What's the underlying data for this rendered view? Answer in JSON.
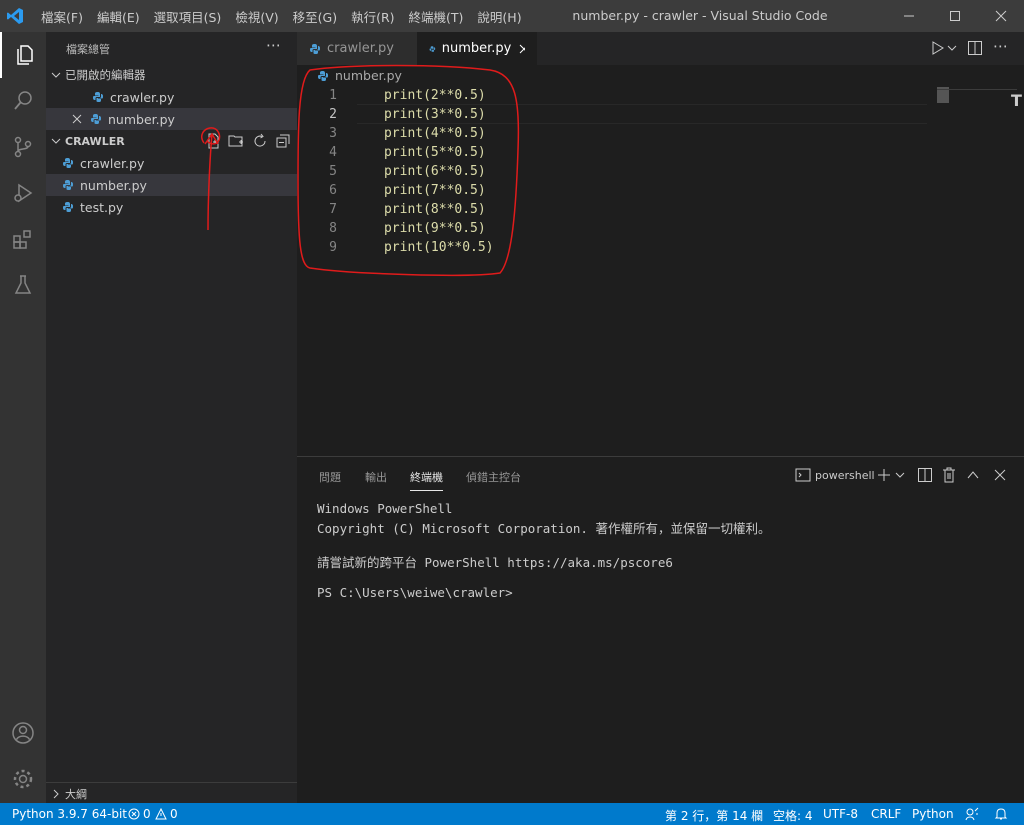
{
  "titlebar": {
    "menus": [
      "檔案(F)",
      "編輯(E)",
      "選取項目(S)",
      "檢視(V)",
      "移至(G)",
      "執行(R)",
      "終端機(T)",
      "說明(H)"
    ],
    "title": "number.py - crawler - Visual Studio Code"
  },
  "sidebar": {
    "header": "檔案總管",
    "open_editors_label": "已開啟的編輯器",
    "open_editors": [
      "crawler.py",
      "number.py"
    ],
    "folder_label": "CRAWLER",
    "files": [
      "crawler.py",
      "number.py",
      "test.py"
    ],
    "outline_label": "大綱"
  },
  "editor": {
    "tabs": [
      "crawler.py",
      "number.py"
    ],
    "breadcrumb": "number.py",
    "lines": [
      {
        "num": "1",
        "text": "print(2**0.5)"
      },
      {
        "num": "2",
        "text": "print(3**0.5)"
      },
      {
        "num": "3",
        "text": "print(4**0.5)"
      },
      {
        "num": "4",
        "text": "print(5**0.5)"
      },
      {
        "num": "5",
        "text": "print(6**0.5)"
      },
      {
        "num": "6",
        "text": "print(7**0.5)"
      },
      {
        "num": "7",
        "text": "print(8**0.5)"
      },
      {
        "num": "8",
        "text": "print(9**0.5)"
      },
      {
        "num": "9",
        "text": "print(10**0.5)"
      }
    ]
  },
  "panel": {
    "tabs": [
      "問題",
      "輸出",
      "終端機",
      "偵錯主控台"
    ],
    "shell_label": "powershell",
    "terminal_lines": [
      "Windows PowerShell",
      "Copyright (C) Microsoft Corporation. 著作權所有，並保留一切權利。",
      "請嘗試新的跨平台 PowerShell https://aka.ms/pscore6",
      "PS C:\\Users\\weiwe\\crawler>"
    ]
  },
  "status": {
    "python": "Python 3.9.7 64-bit",
    "errors": "0",
    "warnings": "0",
    "position": "第 2 行，第 14 欄",
    "spaces": "空格: 4",
    "encoding": "UTF-8",
    "eol": "CRLF",
    "language": "Python"
  },
  "colors": {
    "accent": "#007acc",
    "annotation": "#e01b1b"
  }
}
